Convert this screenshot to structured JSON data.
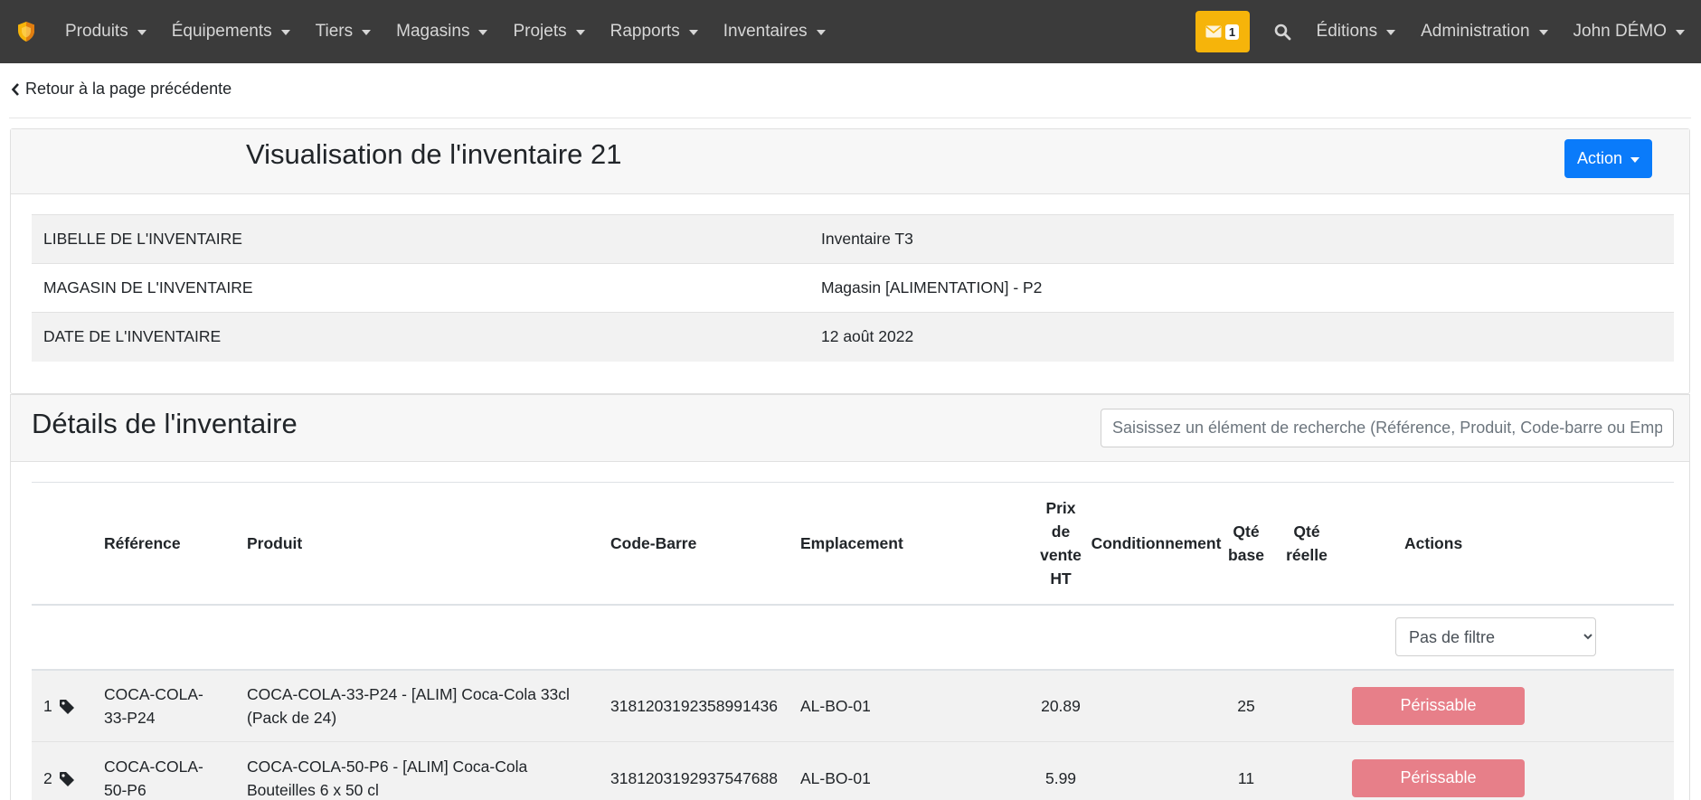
{
  "navbar": {
    "brand_icon": "shield-icon",
    "items": [
      {
        "label": "Produits"
      },
      {
        "label": "Équipements"
      },
      {
        "label": "Tiers"
      },
      {
        "label": "Magasins"
      },
      {
        "label": "Projets"
      },
      {
        "label": "Rapports"
      },
      {
        "label": "Inventaires"
      }
    ],
    "mail_count": "1",
    "right_items": [
      {
        "label": "Éditions"
      },
      {
        "label": "Administration"
      },
      {
        "label": "John DÉMO"
      }
    ],
    "colors": {
      "bar": "#3b3b3b",
      "mail": "#f6b40a"
    }
  },
  "back_link": "Retour à la page précédente",
  "inventory": {
    "title": "Visualisation de l'inventaire 21",
    "action_label": "Action",
    "fields": [
      {
        "label": "LIBELLE DE L'INVENTAIRE",
        "value": "Inventaire T3"
      },
      {
        "label": "MAGASIN DE L'INVENTAIRE",
        "value": "Magasin [ALIMENTATION] - P2"
      },
      {
        "label": "DATE DE L'INVENTAIRE",
        "value": "12 août 2022"
      }
    ]
  },
  "details": {
    "title": "Détails de l'inventaire",
    "search_placeholder": "Saisissez un élément de recherche (Référence, Produit, Code-barre ou Emplacement)",
    "columns": {
      "reference": "Référence",
      "product": "Produit",
      "barcode": "Code-Barre",
      "location": "Emplacement",
      "price_1": "Prix",
      "price_2": "de",
      "price_3": "vente",
      "price_4": "HT",
      "packaging": "Conditionnement",
      "qty_base_1": "Qté",
      "qty_base_2": "base",
      "qty_real_1": "Qté",
      "qty_real_2": "réelle",
      "actions": "Actions"
    },
    "filter": {
      "selected": "Pas de filtre"
    },
    "rows": [
      {
        "num": "1",
        "ref_1": "COCA-COLA-",
        "ref_2": "33-P24",
        "product_1": "COCA-COLA-33-P24 - [ALIM] Coca-Cola 33cl",
        "product_2": "(Pack de 24)",
        "barcode": "3181203192358991436",
        "location": "AL-BO-01",
        "price": "20.89",
        "packaging": "",
        "qty_base": "25",
        "qty_real": "",
        "action": "Périssable"
      },
      {
        "num": "2",
        "ref_1": "COCA-COLA-",
        "ref_2": "50-P6",
        "product_1": "COCA-COLA-50-P6 - [ALIM] Coca-Cola",
        "product_2": "Bouteilles 6 x 50 cl",
        "barcode": "3181203192937547688",
        "location": "AL-BO-01",
        "price": "5.99",
        "packaging": "",
        "qty_base": "11",
        "qty_real": "",
        "action": "Périssable"
      }
    ],
    "colors": {
      "perishable": "#e77f89",
      "action": "#0a7bfa"
    }
  }
}
